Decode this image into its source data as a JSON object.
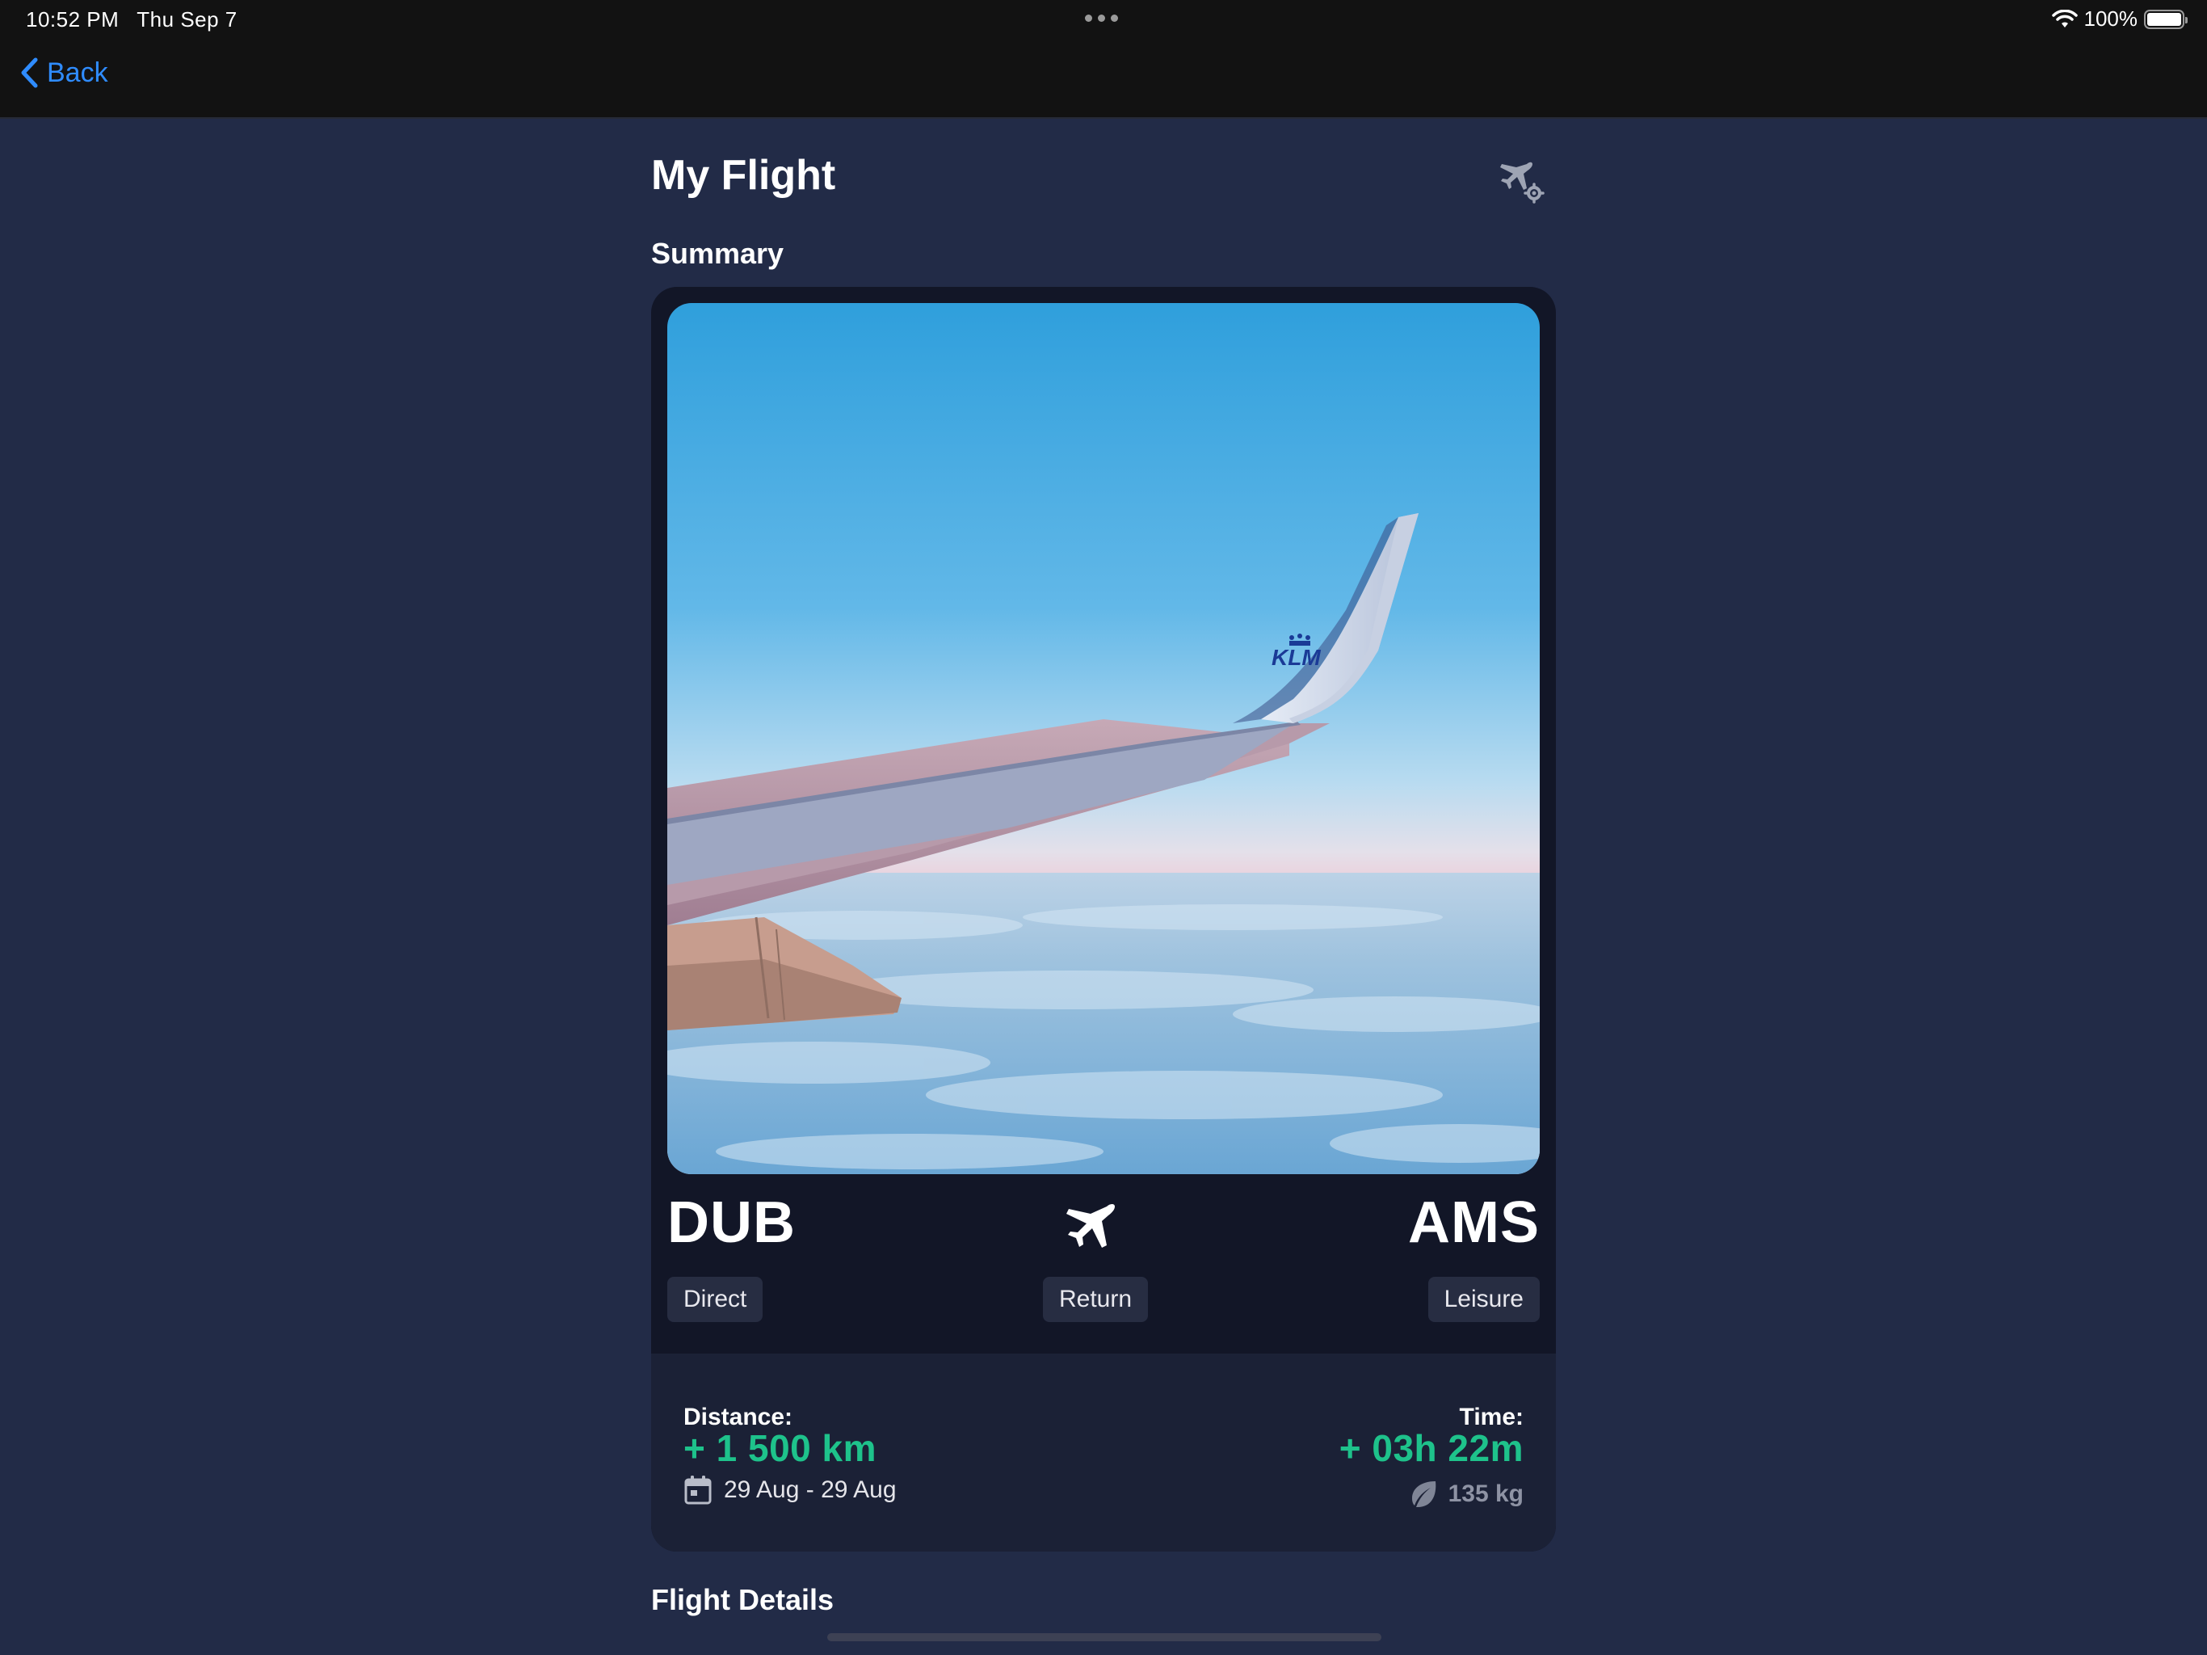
{
  "status_bar": {
    "time": "10:52 PM",
    "date": "Thu Sep 7",
    "battery": "100%"
  },
  "nav": {
    "back_label": "Back"
  },
  "page": {
    "title": "My Flight",
    "summary_title": "Summary",
    "details_title": "Flight Details"
  },
  "photo": {
    "airline_logo_text": "KLM"
  },
  "flight": {
    "from": "DUB",
    "to": "AMS",
    "tags": {
      "stops": "Direct",
      "trip_type": "Return",
      "purpose": "Leisure"
    }
  },
  "stats": {
    "distance_label": "Distance:",
    "distance_value": "+ 1 500 km",
    "time_label": "Time:",
    "time_value": "+ 03h 22m",
    "dates": "29 Aug - 29 Aug",
    "emissions": "135 kg"
  },
  "colors": {
    "background": "#222b47",
    "card": "#121627",
    "accent_green": "#1ec28b",
    "link_blue": "#2f8cff"
  },
  "icons": {
    "back": "chevron-left-icon",
    "settings": "plane-gear-icon",
    "plane": "airplane-icon",
    "calendar": "calendar-icon",
    "leaf": "leaf-icon"
  }
}
